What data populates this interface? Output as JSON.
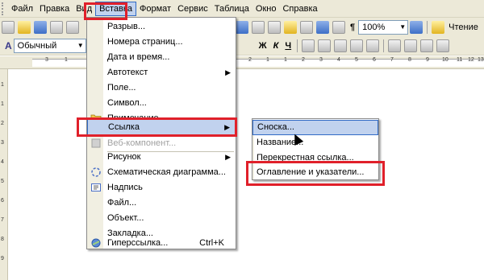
{
  "menubar": {
    "items": [
      "Файл",
      "Правка",
      "Вид",
      "Вставка",
      "Формат",
      "Сервис",
      "Таблица",
      "Окно",
      "Справка"
    ],
    "active_index": 3
  },
  "toolbar": {
    "zoom_value": "100%",
    "read_label": "Чтение"
  },
  "formatting": {
    "style_value": "Обычный",
    "bold": "Ж",
    "italic": "К",
    "underline": "Ч"
  },
  "ruler": {
    "ticks": [
      "3",
      "1",
      "2",
      "1",
      "1",
      "2",
      "3",
      "4",
      "5",
      "6",
      "7",
      "8",
      "9",
      "10",
      "11",
      "12",
      "13"
    ],
    "vticks": [
      "1",
      "1",
      "2",
      "3",
      "4",
      "5",
      "6",
      "7",
      "8",
      "9"
    ]
  },
  "insert_menu": {
    "items": [
      {
        "label": "Разрыв...",
        "icon": ""
      },
      {
        "label": "Номера страниц...",
        "icon": ""
      },
      {
        "label": "Дата и время...",
        "icon": ""
      },
      {
        "label": "Автотекст",
        "icon": "",
        "submenu": true
      },
      {
        "label": "Поле...",
        "icon": ""
      },
      {
        "label": "Символ...",
        "icon": ""
      },
      {
        "label": "Примечание",
        "icon": "folder-icon"
      },
      {
        "label": "Ссылка",
        "icon": "",
        "submenu": true,
        "highlighted": true
      },
      {
        "label": "Веб-компонент...",
        "icon": "web-component-icon",
        "disabled": true
      },
      {
        "label": "Рисунок",
        "icon": "",
        "submenu": true
      },
      {
        "label": "Схематическая диаграмма...",
        "icon": "diagram-icon"
      },
      {
        "label": "Надпись",
        "icon": "textbox-icon"
      },
      {
        "label": "Файл...",
        "icon": ""
      },
      {
        "label": "Объект...",
        "icon": ""
      },
      {
        "label": "Закладка...",
        "icon": ""
      },
      {
        "label": "Гиперссылка...",
        "icon": "hyperlink-icon",
        "shortcut": "Ctrl+K"
      }
    ]
  },
  "link_submenu": {
    "items": [
      {
        "label": "Сноска...",
        "highlighted": true
      },
      {
        "label": "Название..."
      },
      {
        "label": "Перекрестная ссылка..."
      },
      {
        "label": "Оглавление и указатели..."
      }
    ]
  },
  "colors": {
    "highlight": "#c1d2ee",
    "highlight_border": "#316ac5",
    "annotation_red": "#e0202a",
    "chrome": "#ece9d8"
  }
}
